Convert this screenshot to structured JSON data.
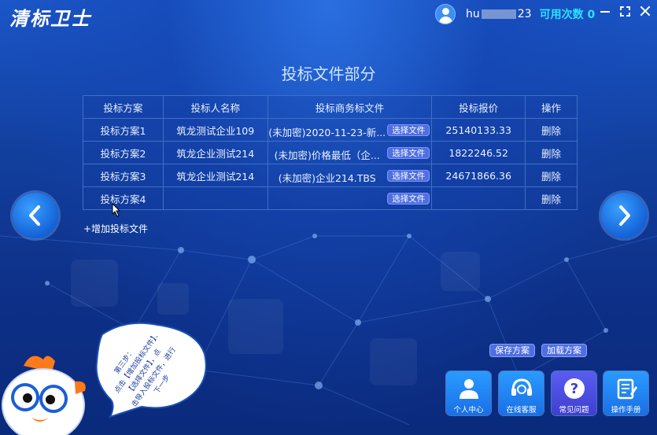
{
  "app": {
    "logo": "清标卫士",
    "user_prefix": "hu",
    "user_suffix": "23",
    "uses_label": "可用次数 0"
  },
  "page": {
    "title": "投标文件部分",
    "add_label": "+增加投标文件"
  },
  "table": {
    "headers": [
      "投标方案",
      "投标人名称",
      "投标商务标文件",
      "投标报价",
      "操作"
    ],
    "select_label": "选择文件",
    "delete_label": "删除",
    "rows": [
      {
        "plan": "投标方案1",
        "bidder": "筑龙测试企业109",
        "file": "(未加密)2020-11-23-新...",
        "price": "25140133.33"
      },
      {
        "plan": "投标方案2",
        "bidder": "筑龙企业测试214",
        "file": "(未加密)价格最低（企...",
        "price": "1822246.52"
      },
      {
        "plan": "投标方案3",
        "bidder": "筑龙企业测试214",
        "file": "(未加密)企业214.TBS",
        "price": "24671866.36"
      },
      {
        "plan": "投标方案4",
        "bidder": "",
        "file": "",
        "price": ""
      }
    ]
  },
  "actions": {
    "save": "保存方案",
    "load": "加载方案"
  },
  "tiles": [
    {
      "label": "个人中心",
      "icon": "user-icon"
    },
    {
      "label": "在线客服",
      "icon": "headset-icon"
    },
    {
      "label": "常见问题",
      "icon": "question-icon"
    },
    {
      "label": "操作手册",
      "icon": "manual-icon"
    }
  ],
  "bubble": {
    "lines": [
      "第三步：",
      "点击【增加投标文件】、",
      "【选择文件】，点",
      "击导入投标文件，进行",
      "下一步"
    ]
  },
  "colors": {
    "accent": "#2ee0ff",
    "button": "#4f6fe0",
    "tile": "#1a6fe6",
    "tile_purple": "#3f3fcf"
  }
}
